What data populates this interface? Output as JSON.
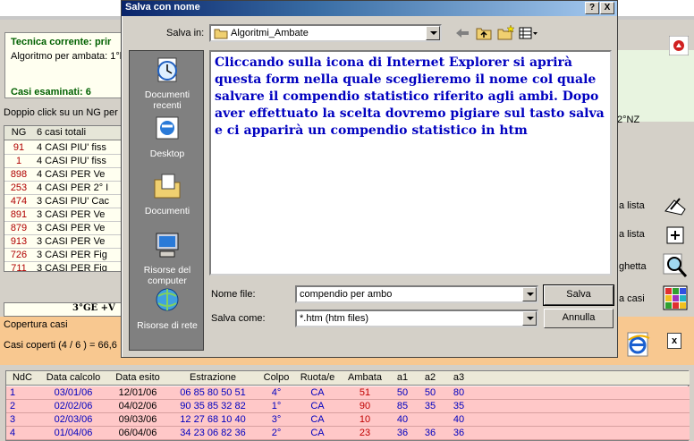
{
  "background": {
    "tech_title": "Tecnica corrente: prir",
    "tech_line": "Algoritmo per ambata: 1°l",
    "casi_esaminati": "Casi esaminati: 6",
    "hint": "Doppio click su un NG per",
    "ng_table": {
      "headers": [
        "NG",
        "6 casi totali"
      ],
      "rows": [
        {
          "ng": "91",
          "desc": "4 CASI PIU' fiss"
        },
        {
          "ng": "1",
          "desc": "4 CASI PIU' fiss"
        },
        {
          "ng": "898",
          "desc": "4 CASI PER Ve"
        },
        {
          "ng": "253",
          "desc": "4 CASI PER 2° I"
        },
        {
          "ng": "474",
          "desc": "3 CASI PIU' Cac"
        },
        {
          "ng": "891",
          "desc": "3 CASI PER Ve"
        },
        {
          "ng": "879",
          "desc": "3 CASI PER Ve"
        },
        {
          "ng": "913",
          "desc": "3 CASI PER Ve"
        },
        {
          "ng": "726",
          "desc": "3 CASI PER Fig"
        },
        {
          "ng": "711",
          "desc": "3 CASI PER Fig"
        }
      ]
    },
    "ge_bar": "3°GE +V",
    "copertura_title": "Copertura casi",
    "copertura_line": "Casi coperti (4 / 6 ) = 66,6",
    "nz_label": "2°NZ",
    "side_labels": [
      "a lista",
      "a lista",
      "ghetta",
      "a casi"
    ],
    "bottom_table": {
      "headers": [
        "NdC",
        "Data calcolo",
        "Data esito",
        "Estrazione",
        "Colpo",
        "Ruota/e",
        "Ambata",
        "a1",
        "a2",
        "a3"
      ],
      "rows": [
        [
          "1",
          "03/01/06",
          "12/01/06",
          "06 85 80 50 51",
          "4°",
          "CA",
          "51",
          "50",
          "50",
          "80"
        ],
        [
          "2",
          "02/02/06",
          "04/02/06",
          "90 35 85 32 82",
          "1°",
          "CA",
          "90",
          "85",
          "35",
          "35"
        ],
        [
          "3",
          "02/03/06",
          "09/03/06",
          "12 27 68 10 40",
          "3°",
          "CA",
          "10",
          "40",
          "",
          "40"
        ],
        [
          "4",
          "01/04/06",
          "06/04/06",
          "34 23 06 82 36",
          "2°",
          "CA",
          "23",
          "36",
          "36",
          "36"
        ]
      ]
    }
  },
  "dialog": {
    "title": "Salva con nome",
    "help_btn": "?",
    "close_btn": "X",
    "save_in_label": "Salva in:",
    "save_in_value": "Algoritmi_Ambate",
    "places": [
      "Documenti recenti",
      "Desktop",
      "Documenti",
      "Risorse del computer",
      "Risorse di rete"
    ],
    "file_area_text": "Cliccando sulla icona di Internet Explorer si aprirà questa form nella quale sceglieremo il nome col quale salvare il compendio statistico riferito agli ambi. Dopo aver effettuato la scelta dovremo pigiare sul tasto salva e ci apparirà un compendio statistico in htm",
    "file_name_label": "Nome file:",
    "file_name_value": "compendio per ambo",
    "save_as_label": "Salva come:",
    "save_as_value": "*.htm (htm files)",
    "save_button": "Salva",
    "cancel_button": "Annulla"
  },
  "colors": {
    "title_start": "#0a246a",
    "title_end": "#a6caf0",
    "instruction_text": "#0000c0",
    "row_pink": "#ffc8c8",
    "copertura_orange": "#f8c890"
  }
}
